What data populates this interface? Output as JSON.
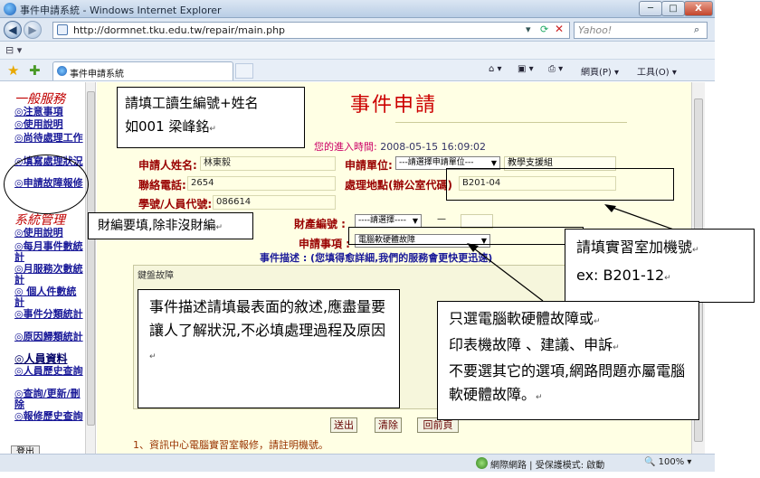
{
  "window": {
    "title": "事件申請系統 - Windows Internet Explorer",
    "min_label": "─",
    "max_label": "□",
    "close_label": "X"
  },
  "browser": {
    "back_glyph": "◀",
    "forward_glyph": "▶",
    "url": "http://dormnet.tku.edu.tw/repair/main.php",
    "search_placeholder": "Yahoo!",
    "tab_label": "事件申請系統",
    "page_menu": "網頁(P) ▾",
    "tools_menu": "工具(O) ▾",
    "status_zone": "網際網路 | 受保護模式: 啟動",
    "zoom": "100%",
    "icons": [
      "ie-logo-icon",
      "back-arrow-icon",
      "forward-arrow-icon",
      "page-icon",
      "refresh-icon",
      "stop-icon",
      "search-icon",
      "favorites-star-icon",
      "add-favorites-icon",
      "home-icon",
      "feed-icon",
      "print-icon",
      "globe-icon"
    ]
  },
  "sidebar": {
    "section1": "一般服務",
    "links1": [
      "◎注意事項",
      "◎使用說明",
      "◎尚待處理工作",
      "◎填寫處理狀況",
      "◎申請故障報修"
    ],
    "section2": "系統管理",
    "links2": [
      "◎使用說明",
      "◎每月事件數統計",
      "◎月服務次數統計",
      "◎ 個人件數統計",
      "◎事件分類統計",
      "◎原因歸類統計"
    ],
    "section3": "◎人員資料",
    "links3": [
      "◎人員歷史查詢",
      "◎查詢/更新/刪除",
      "◎報修歷史查詢"
    ],
    "logout": "登出"
  },
  "form": {
    "title": "事件申請",
    "entry_label": "您的進入時間:",
    "entry_time": "2008-05-15 16:09:02",
    "applicant_label": "申請人姓名:",
    "applicant_value": "林東毅",
    "unit_label": "申請單位:",
    "unit_select": "---請選擇申請單位---",
    "unit_value": "教學支援組",
    "phone_label": "聯絡電話:",
    "phone_value": "2654",
    "location_label": "處理地點(辦公室代碼)",
    "location_value": "B201-04",
    "id_label": "學號/人員代號:",
    "id_value": "086614",
    "property_label": "財產編號 :",
    "property_select": "----請選擇----",
    "property_dash": "—",
    "item_label": "申請事項 :",
    "item_select": "電腦軟硬體故障",
    "desc_label": "事件描述 : (您填得愈詳細,我們的服務會更快更迅速)",
    "desc_value": "鍵盤故障",
    "submit": "送出",
    "clear": "清除",
    "back": "回前頁",
    "note": "1、資訊中心電腦實習室報修，請註明機號。"
  },
  "annotations": {
    "name_line1": "請填工讀生編號+姓名",
    "name_line2": "如001 梁峰銘",
    "property_note": "財編要填,除非沒財編",
    "desc_note": "事件描述請填最表面的敘述,應盡量要讓人了解狀況,不必填處理過程及原因",
    "lab_line1": "請填實習室加機號",
    "lab_line2": "ex:   B201-12",
    "item_line1": "只選電腦軟硬體故障或",
    "item_line2": "印表機故障 、建議、申訴",
    "item_line3": "不要選其它的選項,網路問題亦屬電腦軟硬體故障。",
    "return_mark": "↵"
  }
}
